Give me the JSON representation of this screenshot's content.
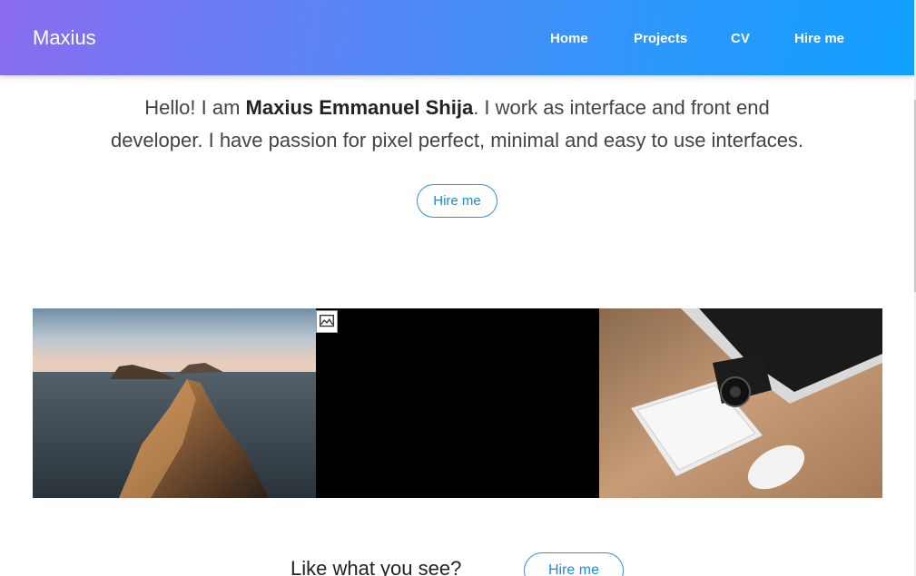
{
  "brand": "Maxius",
  "nav": {
    "home": "Home",
    "projects": "Projects",
    "cv": "CV",
    "hire": "Hire me"
  },
  "intro": {
    "part1": "Hello! I am ",
    "name": "Maxius Emmanuel Shija",
    "part2": ". I work as interface and front end",
    "line2": "developer. I have passion for pixel perfect, minimal and easy to use interfaces."
  },
  "hero_button": "Hire me",
  "gallery": [
    {
      "subject": "coastal-rocks-image"
    },
    {
      "subject": "broken-image"
    },
    {
      "subject": "keyboard-camera-desk-image"
    }
  ],
  "cta": {
    "text": "Like what you see?",
    "button": "Hire me"
  },
  "colors": {
    "gradient_start": "#8a6cf0",
    "gradient_end": "#10a0ff",
    "accent": "#1a8ae6"
  }
}
